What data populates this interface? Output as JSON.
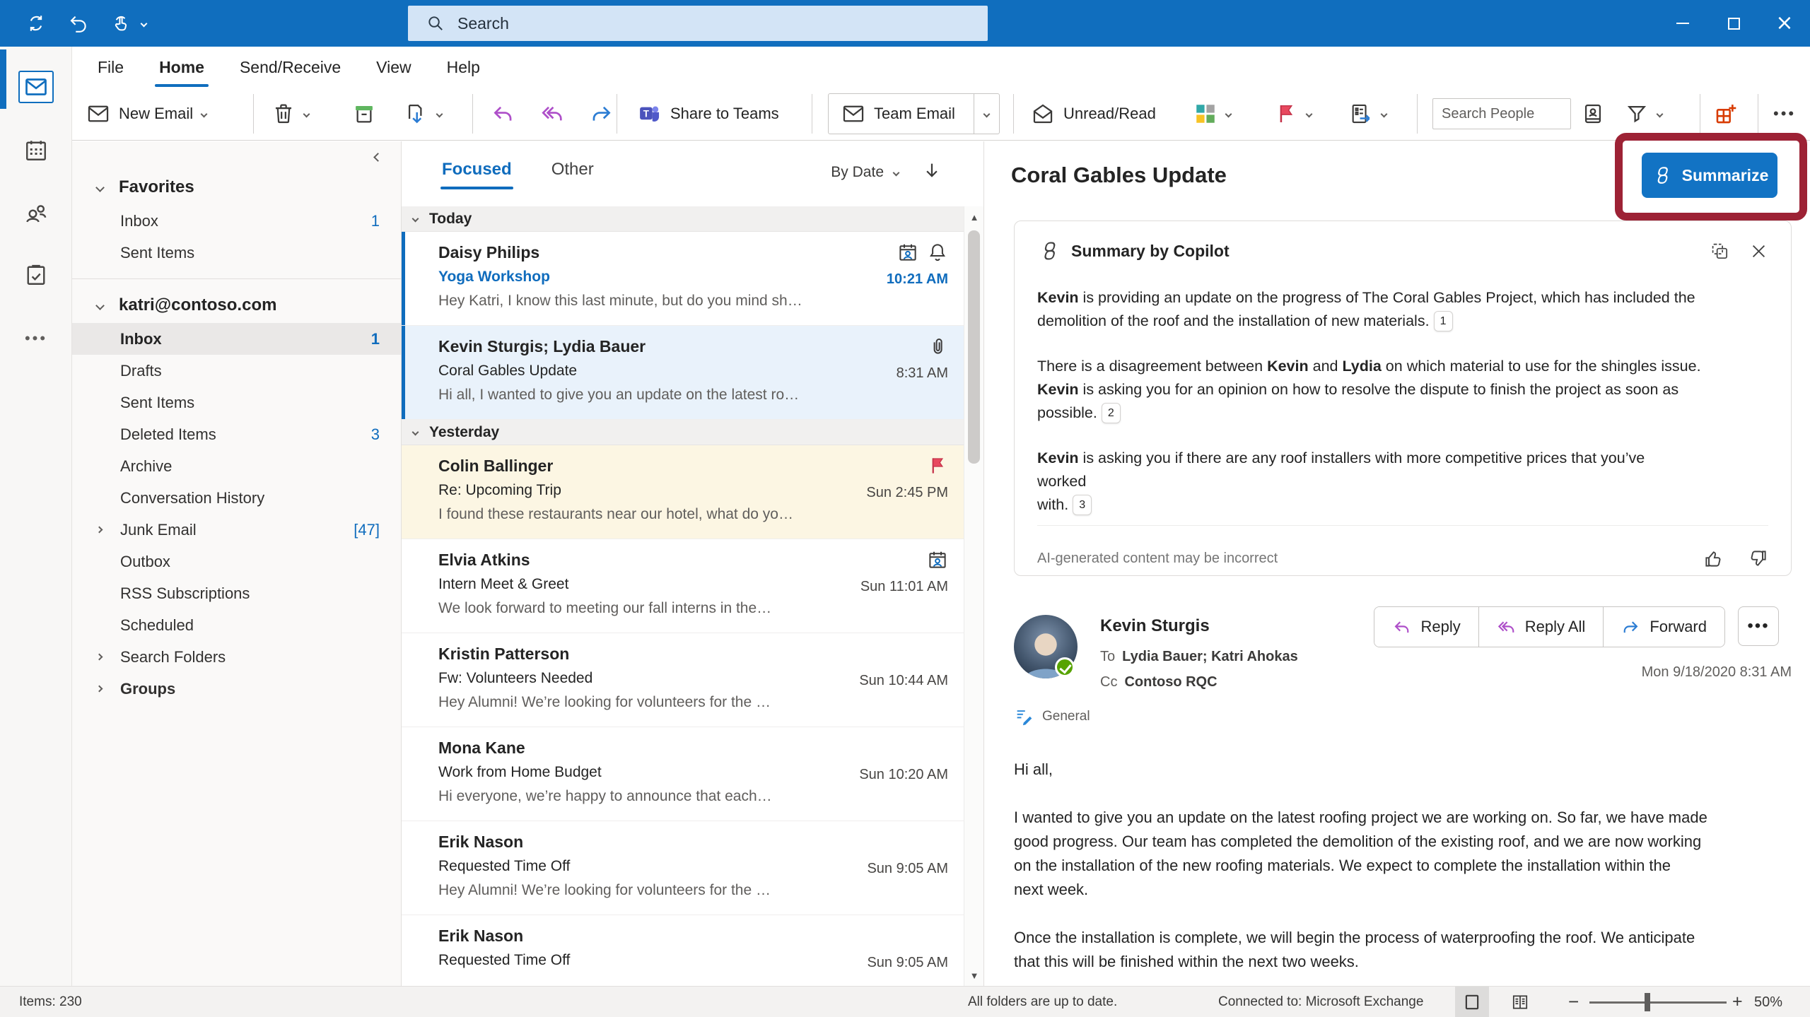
{
  "titlebar": {
    "search_placeholder": "Search",
    "quick_access_icons": [
      "send-receive-icon",
      "undo-icon",
      "touch-mode-icon"
    ]
  },
  "ribbon": {
    "tabs": [
      {
        "label": "File"
      },
      {
        "label": "Home",
        "active": true
      },
      {
        "label": "Send/Receive"
      },
      {
        "label": "View"
      },
      {
        "label": "Help"
      }
    ],
    "toolbar": {
      "new_email": "New Email",
      "share_to_teams": "Share to Teams",
      "team_email": "Team Email",
      "unread_read": "Unread/Read",
      "search_people_placeholder": "Search People"
    }
  },
  "app_rail": [
    "mail",
    "calendar",
    "people",
    "tasks",
    "more"
  ],
  "folder_pane": {
    "sections": [
      {
        "header": "Favorites",
        "items": [
          {
            "label": "Inbox",
            "count": "1"
          },
          {
            "label": "Sent Items"
          }
        ]
      },
      {
        "header": "katri@contoso.com",
        "items": [
          {
            "label": "Inbox",
            "count": "1",
            "selected": true
          },
          {
            "label": "Drafts"
          },
          {
            "label": "Sent Items"
          },
          {
            "label": "Deleted Items",
            "count": "3"
          },
          {
            "label": "Archive"
          },
          {
            "label": "Conversation History"
          },
          {
            "label": "Junk Email",
            "count": "[47]",
            "expandable": true
          },
          {
            "label": "Outbox"
          },
          {
            "label": "RSS Subscriptions"
          },
          {
            "label": "Scheduled"
          },
          {
            "label": "Search Folders",
            "expandable": true
          },
          {
            "label": "Groups",
            "expandable": true,
            "bold": true
          }
        ]
      }
    ]
  },
  "message_list": {
    "tabs": [
      {
        "label": "Focused",
        "active": true
      },
      {
        "label": "Other"
      }
    ],
    "sort_label": "By Date",
    "groups": [
      {
        "label": "Today",
        "items": [
          {
            "sender": "Daisy Philips",
            "subject": "Yoga Workshop",
            "preview": "Hey Katri, I know this last minute, but do you mind sh…",
            "time": "10:21 AM",
            "unread": true,
            "icons": [
              "meeting-icon",
              "reminder-bell-icon"
            ]
          },
          {
            "sender": "Kevin Sturgis; Lydia Bauer",
            "subject": "Coral Gables Update",
            "preview": "Hi all, I wanted to give you an update on the latest ro…",
            "time": "8:31 AM",
            "selected": true,
            "icons": [
              "attachment-icon"
            ]
          }
        ]
      },
      {
        "label": "Yesterday",
        "items": [
          {
            "sender": "Colin Ballinger",
            "subject": "Re: Upcoming Trip",
            "preview": "I found these restaurants near our hotel, what do yo…",
            "time": "Sun 2:45 PM",
            "flagged": true,
            "icons": [
              "flag-icon"
            ]
          },
          {
            "sender": "Elvia Atkins",
            "subject": "Intern Meet & Greet",
            "preview": "We look forward to meeting our fall interns in the…",
            "time": "Sun 11:01 AM",
            "icons": [
              "meeting-icon"
            ]
          },
          {
            "sender": "Kristin Patterson",
            "subject": "Fw: Volunteers Needed",
            "preview": "Hey Alumni! We’re looking for volunteers for the …",
            "time": "Sun 10:44 AM",
            "icons": []
          },
          {
            "sender": "Mona Kane",
            "subject": "Work from Home Budget",
            "preview": "Hi everyone, we’re happy to announce that each…",
            "time": "Sun 10:20 AM",
            "icons": []
          },
          {
            "sender": "Erik Nason",
            "subject": "Requested Time Off",
            "preview": "Hey Alumni! We’re looking for volunteers for the …",
            "time": "Sun 9:05 AM",
            "icons": []
          },
          {
            "sender": "Erik Nason",
            "subject": "Requested Time Off",
            "preview": "",
            "time": "Sun 9:05 AM",
            "icons": []
          }
        ]
      }
    ]
  },
  "reading_pane": {
    "title": "Coral Gables Update",
    "summarize_label": "Summarize",
    "copilot_card": {
      "title": "Summary by Copilot",
      "paragraphs": [
        {
          "segments": [
            {
              "text": "Kevin",
              "bold": true
            },
            {
              "text": " is providing an update on the progress of The Coral Gables Project, which has included the\ndemolition of the roof and the installation of new materials. "
            }
          ],
          "citation": "1"
        },
        {
          "segments": [
            {
              "text": "There is a disagreement between "
            },
            {
              "text": "Kevin",
              "bold": true
            },
            {
              "text": " and "
            },
            {
              "text": "Lydia",
              "bold": true
            },
            {
              "text": " on which material to use for the shingles issue.\n"
            },
            {
              "text": "Kevin",
              "bold": true
            },
            {
              "text": " is asking you for an opinion on how to resolve the dispute to finish the project as soon as\npossible. "
            }
          ],
          "citation": "2"
        },
        {
          "segments": [
            {
              "text": "Kevin",
              "bold": true
            },
            {
              "text": " is asking you if there are any roof installers with more competitive prices that you’ve\nworked\nwith. "
            }
          ],
          "citation": "3"
        }
      ],
      "footer": "AI-generated content may be incorrect"
    },
    "message": {
      "sender": "Kevin Sturgis",
      "to_label": "To",
      "to": "Lydia Bauer; Katri Ahokas",
      "cc_label": "Cc",
      "cc": "Contoso RQC",
      "date": "Mon 9/18/2020 8:31 AM",
      "sensitivity": "General",
      "actions": [
        {
          "label": "Reply",
          "icon": "reply-icon"
        },
        {
          "label": "Reply All",
          "icon": "reply-all-icon"
        },
        {
          "label": "Forward",
          "icon": "forward-icon"
        }
      ],
      "body": [
        "Hi all,",
        "I wanted to give you an update on the latest roofing project we are working on. So far, we have made\ngood progress. Our team has completed the demolition of the existing roof, and we are now working\non the installation of the new roofing materials. We expect to complete the installation within the\nnext week.",
        "Once the installation is complete, we will begin the process of waterproofing the roof. We anticipate\nthat this will be finished within the next two weeks."
      ]
    }
  },
  "status_bar": {
    "items_count": "Items: 230",
    "sync_status": "All folders are up to date.",
    "connection": "Connected to: Microsoft Exchange",
    "zoom_level": "50%"
  }
}
